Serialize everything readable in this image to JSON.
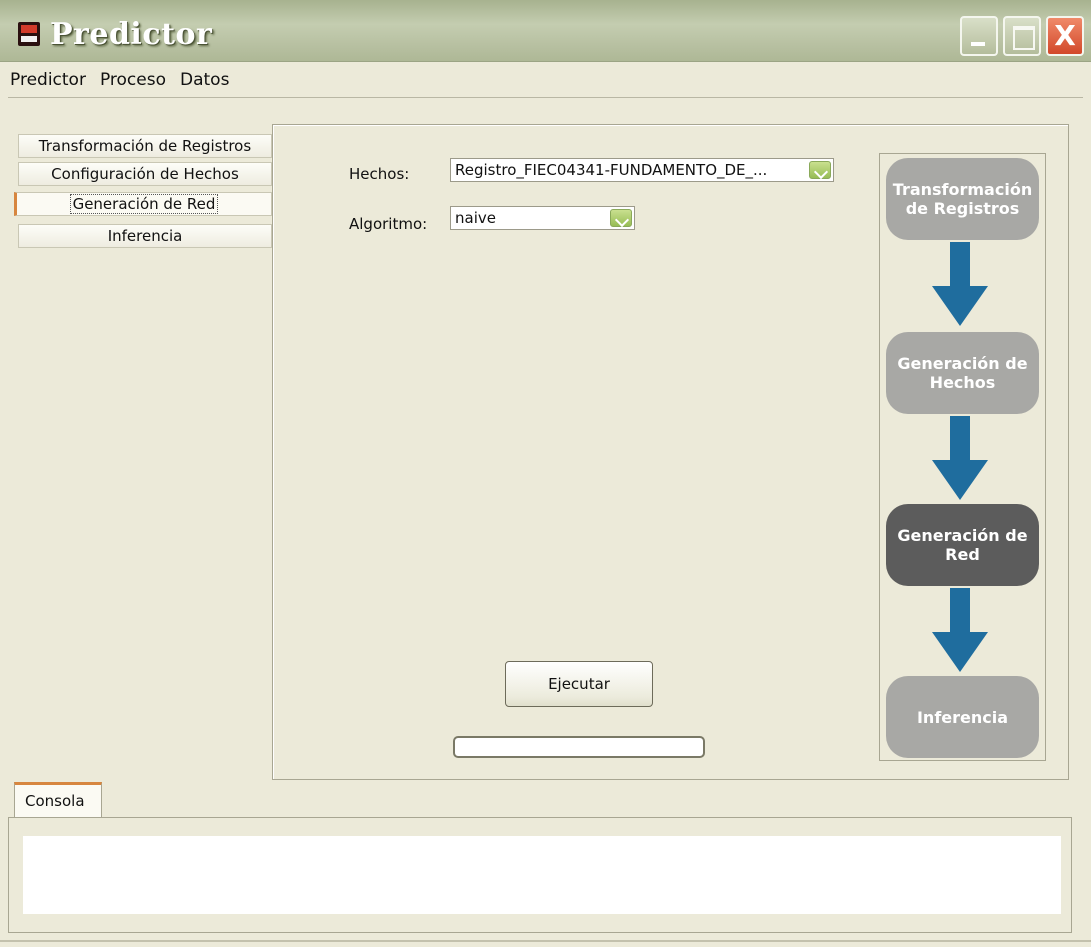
{
  "window": {
    "title": "Predictor",
    "controls": {
      "minimize": "",
      "maximize": "",
      "close": "X"
    }
  },
  "menu": {
    "items": [
      "Predictor",
      "Proceso",
      "Datos"
    ]
  },
  "side_tabs": [
    {
      "label": "Transformación de Registros",
      "selected": false
    },
    {
      "label": "Configuración de Hechos",
      "selected": false
    },
    {
      "label": "Generación de Red",
      "selected": true
    },
    {
      "label": "Inferencia",
      "selected": false
    }
  ],
  "form": {
    "hechos_label": "Hechos:",
    "hechos_value": "Registro_FIEC04341-FUNDAMENTO_DE_...",
    "algoritmo_label": "Algoritmo:",
    "algoritmo_value": "naive",
    "execute_label": "Ejecutar",
    "progress": 0
  },
  "flow": {
    "steps": [
      {
        "line1": "Transformación",
        "line2": "de Registros",
        "active": false
      },
      {
        "line1": "Generación de",
        "line2": "Hechos",
        "active": false
      },
      {
        "line1": "Generación de",
        "line2": "Red",
        "active": true
      },
      {
        "line1": "Inferencia",
        "line2": "",
        "active": false
      }
    ],
    "arrow_color": "#1f6d9e"
  },
  "console": {
    "tab_label": "Consola",
    "content": ""
  },
  "colors": {
    "accent_tab": "#d7863f",
    "active_step": "#5c5c5c",
    "inactive_step": "#a8a8a5"
  }
}
